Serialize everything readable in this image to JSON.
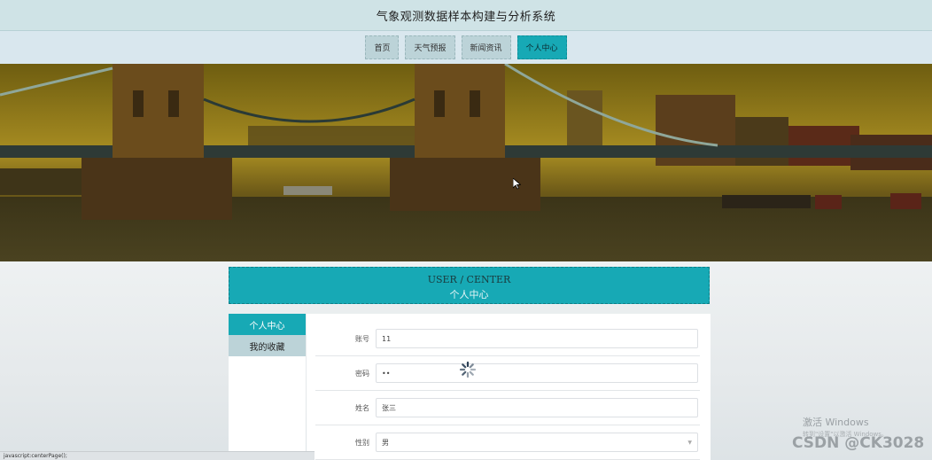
{
  "site": {
    "title": "气象观测数据样本构建与分析系统"
  },
  "nav": {
    "items": [
      {
        "label": "首页"
      },
      {
        "label": "天气预报"
      },
      {
        "label": "新闻资讯"
      },
      {
        "label": "个人中心"
      }
    ]
  },
  "section": {
    "title_en": "USER / CENTER",
    "title_cn": "个人中心"
  },
  "sidebar": {
    "items": [
      {
        "label": "个人中心"
      },
      {
        "label": "我的收藏"
      }
    ]
  },
  "form": {
    "account": {
      "label": "账号",
      "value": "11"
    },
    "password": {
      "label": "密码",
      "value": "••"
    },
    "name": {
      "label": "姓名",
      "value": "张三"
    },
    "gender": {
      "label": "性别",
      "value": "男"
    }
  },
  "statusbar": {
    "text": "javascript:centerPage();"
  },
  "watermark": {
    "title": "激活 Windows",
    "subtitle": "转到\"设置\"以激活 Windows。"
  },
  "csdn": {
    "text": "CSDN @CK3028"
  },
  "colors": {
    "accent": "#17a9b5",
    "nav_bg": "#bcd3d8"
  }
}
